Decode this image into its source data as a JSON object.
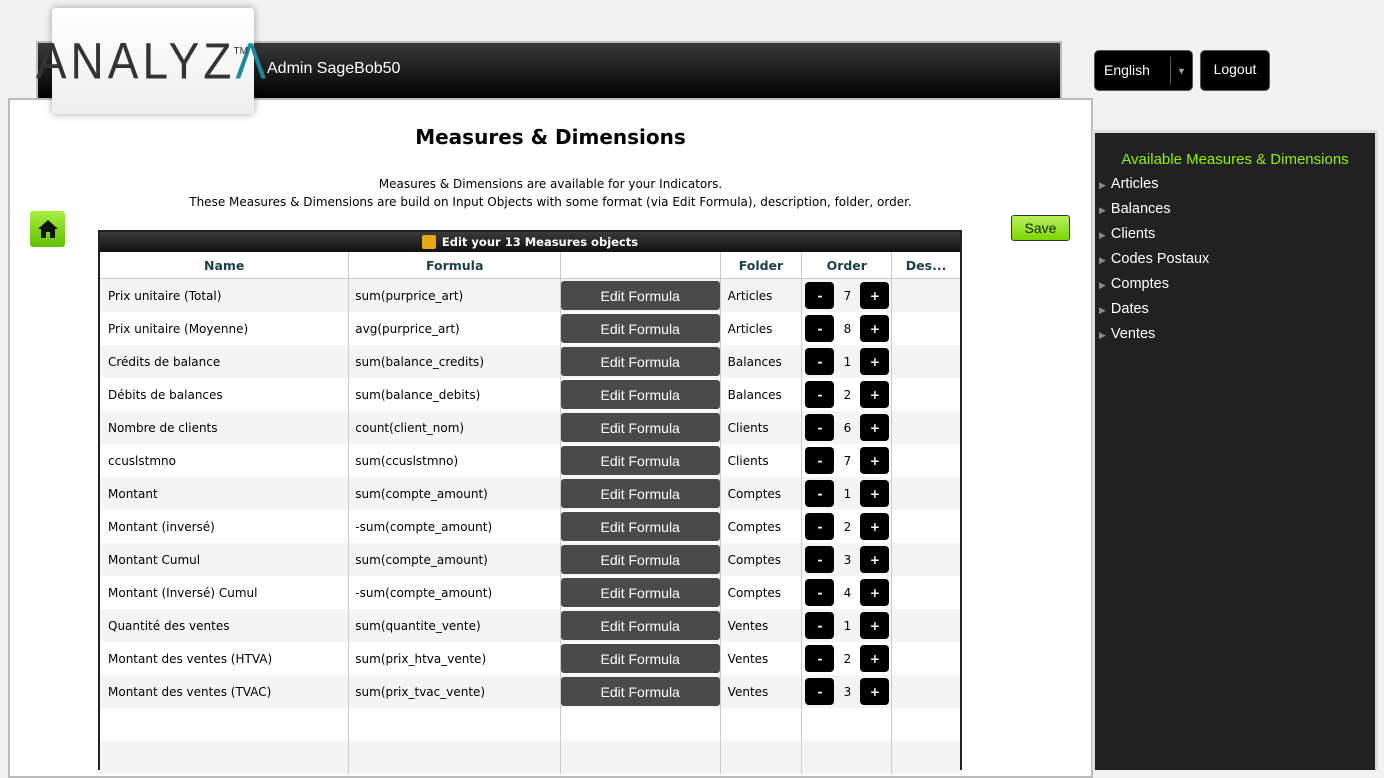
{
  "header": {
    "logo": "ANALYZA",
    "user": "Admin SageBob50"
  },
  "language": {
    "selected": "English"
  },
  "logout_label": "Logout",
  "page": {
    "title": "Measures & Dimensions",
    "subtitle_1": "Measures & Dimensions are available for your Indicators.",
    "subtitle_2": "These Measures & Dimensions are build on Input Objects with some format (via Edit Formula), description, folder, order.",
    "save_label": "Save"
  },
  "grid": {
    "title": "Edit your 13 Measures objects",
    "columns": [
      "Name",
      "Formula",
      "",
      "Folder",
      "Order",
      "Des..."
    ],
    "edit_label": "Edit Formula",
    "minus": "-",
    "plus": "+",
    "rows": [
      {
        "name": "Prix unitaire (Total)",
        "formula": "sum(purprice_art)",
        "folder": "Articles",
        "order": "7"
      },
      {
        "name": "Prix unitaire (Moyenne)",
        "formula": "avg(purprice_art)",
        "folder": "Articles",
        "order": "8"
      },
      {
        "name": "Crédits de balance",
        "formula": "sum(balance_credits)",
        "folder": "Balances",
        "order": "1"
      },
      {
        "name": "Débits de balances",
        "formula": "sum(balance_debits)",
        "folder": "Balances",
        "order": "2"
      },
      {
        "name": "Nombre de clients",
        "formula": "count(client_nom)",
        "folder": "Clients",
        "order": "6"
      },
      {
        "name": "ccuslstmno",
        "formula": "sum(ccuslstmno)",
        "folder": "Clients",
        "order": "7"
      },
      {
        "name": "Montant",
        "formula": "sum(compte_amount)",
        "folder": "Comptes",
        "order": "1"
      },
      {
        "name": "Montant (inversé)",
        "formula": "-sum(compte_amount)",
        "folder": "Comptes",
        "order": "2"
      },
      {
        "name": "Montant Cumul",
        "formula": "sum(compte_amount)",
        "folder": "Comptes",
        "order": "3"
      },
      {
        "name": "Montant (Inversé) Cumul",
        "formula": "-sum(compte_amount)",
        "folder": "Comptes",
        "order": "4"
      },
      {
        "name": "Quantité des ventes",
        "formula": "sum(quantite_vente)",
        "folder": "Ventes",
        "order": "1"
      },
      {
        "name": "Montant des ventes (HTVA)",
        "formula": "sum(prix_htva_vente)",
        "folder": "Ventes",
        "order": "2"
      },
      {
        "name": "Montant des ventes (TVAC)",
        "formula": "sum(prix_tvac_vente)",
        "folder": "Ventes",
        "order": "3"
      }
    ]
  },
  "sidebar": {
    "title": "Available Measures & Dimensions",
    "items": [
      "Articles",
      "Balances",
      "Clients",
      "Codes Postaux",
      "Comptes",
      "Dates",
      "Ventes"
    ]
  }
}
